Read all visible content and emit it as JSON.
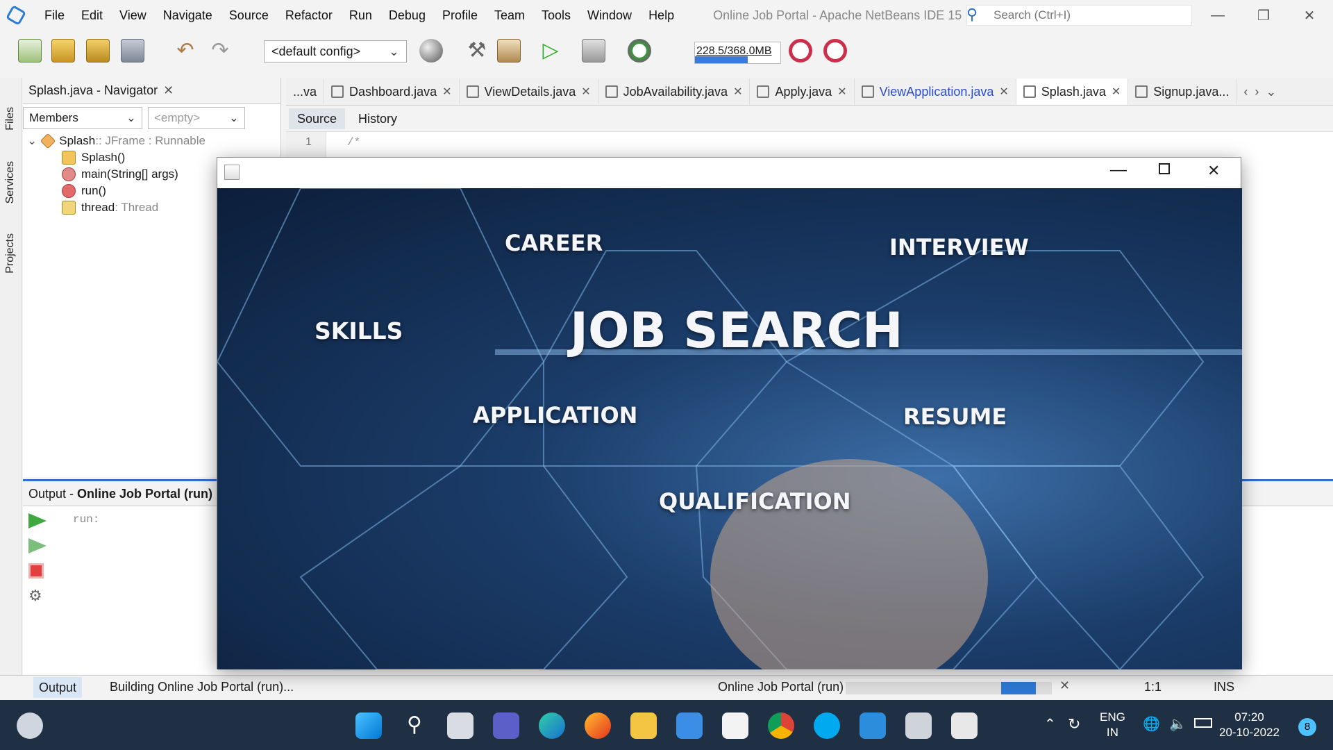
{
  "menu": [
    "File",
    "Edit",
    "View",
    "Navigate",
    "Source",
    "Refactor",
    "Run",
    "Debug",
    "Profile",
    "Team",
    "Tools",
    "Window",
    "Help"
  ],
  "window_title": "Online Job Portal - Apache NetBeans IDE 15",
  "search": {
    "placeholder": "Search (Ctrl+I)"
  },
  "toolbar": {
    "config": "<default config>",
    "memory": "228.5/368.0MB",
    "memory_used_fraction": 0.62
  },
  "side_tabs": [
    "Files",
    "Services",
    "Projects"
  ],
  "navigator": {
    "title": "Splash.java - Navigator",
    "filter": "Members",
    "empty": "<empty>",
    "tree": [
      {
        "label": "Splash",
        "suffix": " :: JFrame : Runnable"
      },
      {
        "label": "Splash()",
        "suffix": ""
      },
      {
        "label": "main(String[] args)",
        "suffix": ""
      },
      {
        "label": "run()",
        "suffix": ""
      },
      {
        "label": "thread",
        "suffix": " : Thread"
      }
    ]
  },
  "editor_tabs": [
    "...va",
    "Dashboard.java",
    "ViewDetails.java",
    "JobAvailability.java",
    "Apply.java",
    "ViewApplication.java",
    "Splash.java",
    "Signup.java..."
  ],
  "editor": {
    "source_tab": "Source",
    "history_tab": "History",
    "line_number": "1",
    "code_line": "/*"
  },
  "output": {
    "label": "Output - ",
    "project": "Online Job Portal (run)",
    "text": "run:"
  },
  "status": {
    "output_tab": "Output",
    "building": "Building Online Job Portal (run)...",
    "run_label": "Online Job Portal (run)",
    "position": "1:1",
    "mode": "INS"
  },
  "splash": {
    "words": {
      "career": "CAREER",
      "interview": "INTERVIEW",
      "skills": "SKILLS",
      "title": "JOB SEARCH",
      "application": "APPLICATION",
      "resume": "RESUME",
      "qualification": "QUALIFICATION"
    }
  },
  "tray": {
    "lang1": "ENG",
    "lang2": "IN",
    "time": "07:20",
    "date": "20-10-2022",
    "badge": "8"
  }
}
